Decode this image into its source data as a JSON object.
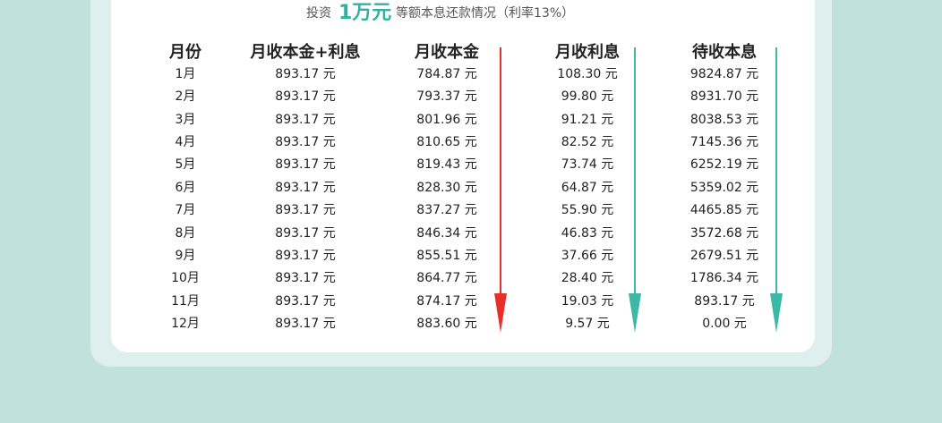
{
  "subtitle": {
    "prefix": "投资",
    "amount": "1万元",
    "suffix": "等额本息还款情况（利率13%）"
  },
  "table": {
    "headers": [
      "月份",
      "月收本金+利息",
      "月收本金",
      "月收利息",
      "待收本息"
    ],
    "rows": [
      [
        "1月",
        "893.17 元",
        "784.87 元",
        "108.30 元",
        "9824.87 元"
      ],
      [
        "2月",
        "893.17 元",
        "793.37 元",
        "99.80 元",
        "8931.70 元"
      ],
      [
        "3月",
        "893.17 元",
        "801.96 元",
        "91.21 元",
        "8038.53 元"
      ],
      [
        "4月",
        "893.17 元",
        "810.65 元",
        "82.52 元",
        "7145.36 元"
      ],
      [
        "5月",
        "893.17 元",
        "819.43 元",
        "73.74 元",
        "6252.19 元"
      ],
      [
        "6月",
        "893.17 元",
        "828.30 元",
        "64.87 元",
        "5359.02 元"
      ],
      [
        "7月",
        "893.17 元",
        "837.27 元",
        "55.90 元",
        "4465.85 元"
      ],
      [
        "8月",
        "893.17 元",
        "846.34 元",
        "46.83 元",
        "3572.68 元"
      ],
      [
        "9月",
        "893.17 元",
        "855.51 元",
        "37.66 元",
        "2679.51 元"
      ],
      [
        "10月",
        "893.17 元",
        "864.77 元",
        "28.40 元",
        "1786.34 元"
      ],
      [
        "11月",
        "893.17 元",
        "874.17 元",
        "19.03 元",
        "893.17 元"
      ],
      [
        "12月",
        "893.17 元",
        "883.60 元",
        "9.57 元",
        "0.00 元"
      ]
    ]
  },
  "arrows": [
    {
      "name": "principal-trend-arrow",
      "color": "#e8302a"
    },
    {
      "name": "interest-trend-arrow",
      "color": "#3bb8a6"
    },
    {
      "name": "remaining-trend-arrow",
      "color": "#3bb8a6"
    }
  ],
  "colors": {
    "background": "#c0e1dc",
    "panel": "#dfefee",
    "card": "#ffffff",
    "accent": "#2eb3a0",
    "down_red": "#e8302a",
    "down_teal": "#3bb8a6"
  }
}
